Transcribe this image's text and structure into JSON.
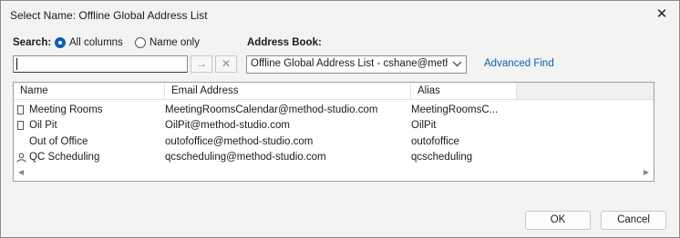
{
  "window": {
    "title": "Select Name: Offline Global Address List"
  },
  "search": {
    "label": "Search:",
    "option_all": "All columns",
    "option_name": "Name only",
    "selected": "All columns",
    "value": "",
    "go_icon": "arrow-right-icon",
    "clear_icon": "x-icon"
  },
  "address_book": {
    "label": "Address Book:",
    "selected": "Offline Global Address List - cshane@method-studio.com",
    "advanced_find": "Advanced Find"
  },
  "list": {
    "columns": [
      "Name",
      "Email Address",
      "Alias"
    ],
    "rows": [
      {
        "icon": "group-icon",
        "name": "Meeting Rooms",
        "email": "MeetingRoomsCalendar@method-studio.com",
        "alias": "MeetingRoomsC..."
      },
      {
        "icon": "group-icon",
        "name": "Oil Pit",
        "email": "OilPit@method-studio.com",
        "alias": "OilPit"
      },
      {
        "icon": "",
        "name": "Out of Office",
        "email": "outofoffice@method-studio.com",
        "alias": "outofoffice"
      },
      {
        "icon": "person-icon",
        "name": "QC Scheduling",
        "email": "qcscheduling@method-studio.com",
        "alias": "qcscheduling"
      }
    ]
  },
  "buttons": {
    "ok": "OK",
    "cancel": "Cancel"
  },
  "colors": {
    "accent": "#0a5fb4",
    "link": "#0a61b3",
    "background": "#f3f3f3"
  }
}
